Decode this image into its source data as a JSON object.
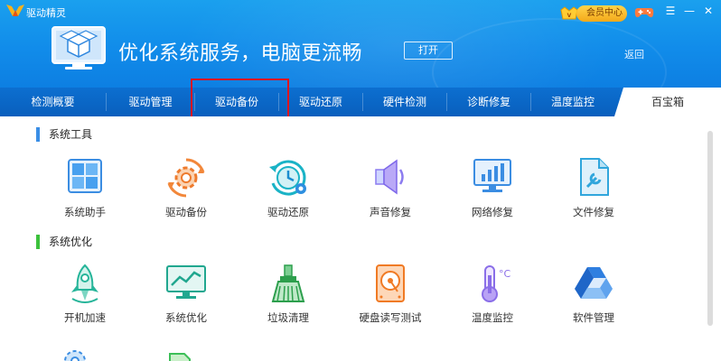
{
  "window": {
    "title": "驱动精灵",
    "member_label": "会员中心",
    "vip_label": "VIP"
  },
  "banner": {
    "title": "优化系统服务，电脑更流畅",
    "open_label": "打开",
    "back_label": "返回"
  },
  "tabs": [
    {
      "label": "检测概要",
      "active": false
    },
    {
      "label": "驱动管理",
      "active": false
    },
    {
      "label": "驱动备份",
      "active": false
    },
    {
      "label": "驱动还原",
      "active": false
    },
    {
      "label": "硬件检测",
      "active": false
    },
    {
      "label": "诊断修复",
      "active": false
    },
    {
      "label": "温度监控",
      "active": false
    },
    {
      "label": "百宝箱",
      "active": true
    }
  ],
  "sections": [
    {
      "title": "系统工具",
      "accent": "#3a8ee6",
      "items": [
        {
          "label": "系统助手",
          "icon": "windows-icon"
        },
        {
          "label": "驱动备份",
          "icon": "gear-refresh-icon"
        },
        {
          "label": "驱动还原",
          "icon": "clock-restore-icon"
        },
        {
          "label": "声音修复",
          "icon": "speaker-icon"
        },
        {
          "label": "网络修复",
          "icon": "network-monitor-icon"
        },
        {
          "label": "文件修复",
          "icon": "file-wrench-icon"
        }
      ]
    },
    {
      "title": "系统优化",
      "accent": "#3cc13c",
      "items": [
        {
          "label": "开机加速",
          "icon": "rocket-icon"
        },
        {
          "label": "系统优化",
          "icon": "monitor-chart-icon"
        },
        {
          "label": "垃圾清理",
          "icon": "broom-icon"
        },
        {
          "label": "硬盘读写测试",
          "icon": "hard-disk-icon"
        },
        {
          "label": "温度监控",
          "icon": "thermometer-icon"
        },
        {
          "label": "软件管理",
          "icon": "software-triangle-icon"
        }
      ]
    }
  ],
  "colors": {
    "header": "#118cea",
    "tabbar": "#0a66c6",
    "highlight": "#e0141e"
  }
}
